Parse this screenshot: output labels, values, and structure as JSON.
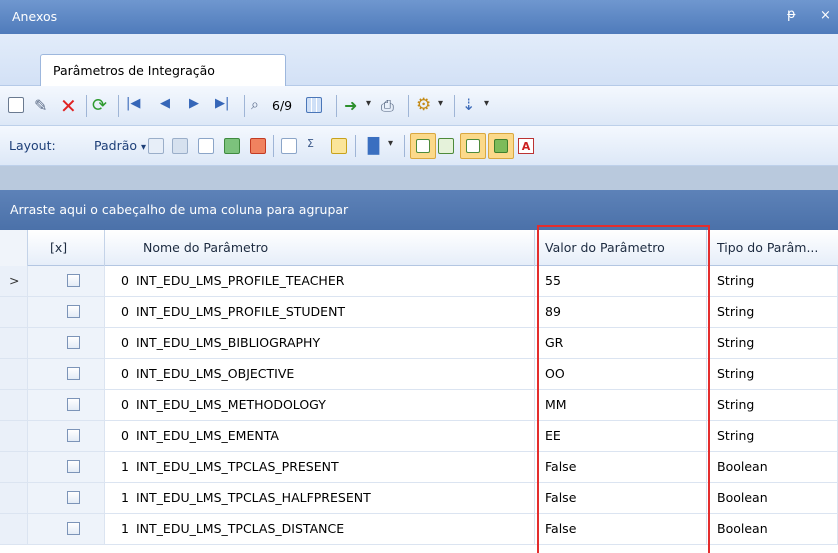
{
  "panel": {
    "title": "Anexos",
    "pin_glyph": "ᵽ",
    "close_glyph": "×"
  },
  "tab": {
    "label": "Parâmetros de Integração"
  },
  "navigator": {
    "record_position": "6/9"
  },
  "layout_bar": {
    "label": "Layout:",
    "preset": "Padrão",
    "preset_arrow": "▾"
  },
  "group_panel": {
    "hint": "Arraste aqui o cabeçalho de uma coluna para agrupar"
  },
  "grid": {
    "columns": {
      "select": "[x]",
      "name": "Nome do Parâmetro",
      "value": "Valor do Parâmetro",
      "type": "Tipo do Parâm..."
    },
    "current_row_marker": ">",
    "rows": [
      {
        "idx": "0",
        "name": "INT_EDU_LMS_PROFILE_TEACHER",
        "value": "55",
        "type": "String"
      },
      {
        "idx": "0",
        "name": "INT_EDU_LMS_PROFILE_STUDENT",
        "value": "89",
        "type": "String"
      },
      {
        "idx": "0",
        "name": "INT_EDU_LMS_BIBLIOGRAPHY",
        "value": "GR",
        "type": "String"
      },
      {
        "idx": "0",
        "name": "INT_EDU_LMS_OBJECTIVE",
        "value": "OO",
        "type": "String"
      },
      {
        "idx": "0",
        "name": "INT_EDU_LMS_METHODOLOGY",
        "value": "MM",
        "type": "String"
      },
      {
        "idx": "0",
        "name": "INT_EDU_LMS_EMENTA",
        "value": "EE",
        "type": "String"
      },
      {
        "idx": "1",
        "name": "INT_EDU_LMS_TPCLAS_PRESENT",
        "value": "False",
        "type": "Boolean"
      },
      {
        "idx": "1",
        "name": "INT_EDU_LMS_TPCLAS_HALFPRESENT",
        "value": "False",
        "type": "Boolean"
      },
      {
        "idx": "1",
        "name": "INT_EDU_LMS_TPCLAS_DISTANCE",
        "value": "False",
        "type": "Boolean"
      }
    ]
  },
  "colors": {
    "highlight_border": "#e32d2d",
    "header_blue": "#5d82b8"
  }
}
